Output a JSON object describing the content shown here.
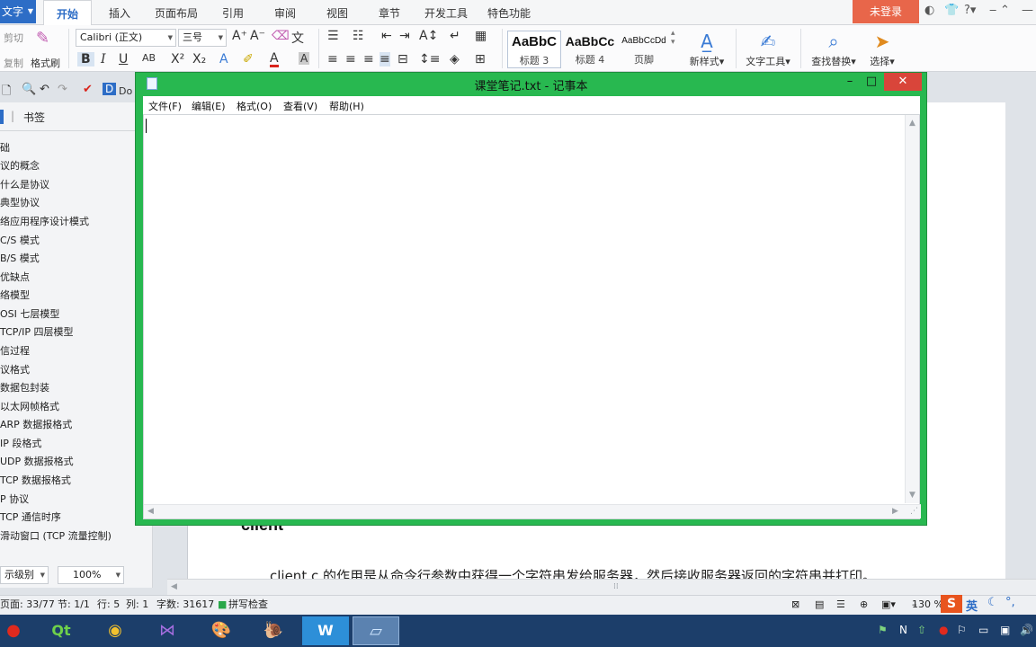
{
  "ribbon": {
    "app_menu": "文字",
    "tabs": [
      "开始",
      "插入",
      "页面布局",
      "引用",
      "审阅",
      "视图",
      "章节",
      "开发工具",
      "特色功能"
    ],
    "login": "未登录",
    "clipboard": {
      "cut": "剪切",
      "copy": "复制",
      "format_painter": "格式刷"
    },
    "font": {
      "name": "Calibri (正文)",
      "size": "三号"
    },
    "styles": [
      {
        "sample": "AaBbC",
        "name": "标题 3"
      },
      {
        "sample": "AaBbCc",
        "name": "标题 4"
      },
      {
        "sample": "AaBbCcDd",
        "name": "页脚"
      }
    ],
    "new_style": "新样式",
    "text_tools": "文字工具",
    "find_replace": "查找替换",
    "select": "选择"
  },
  "quickbar": {
    "doc_label": "Do"
  },
  "navpane": {
    "tab_bookmark": "书签",
    "items": [
      "础",
      "议的概念",
      "什么是协议",
      "典型协议",
      "络应用程序设计模式",
      "C/S 模式",
      "B/S 模式",
      "优缺点",
      "络模型",
      "OSI 七层模型",
      "TCP/IP 四层模型",
      "信过程",
      "议格式",
      "数据包封装",
      "以太网帧格式",
      "ARP 数据报格式",
      "IP 段格式",
      "UDP 数据报格式",
      "TCP 数据报格式",
      "P 协议",
      "TCP 通信时序",
      "滑动窗口 (TCP 流量控制)"
    ],
    "level": "示级别",
    "zoom": "100%"
  },
  "document": {
    "heading": "client",
    "paragraph": "client.c 的作用是从命令行参数中获得一个字符串发给服务器，然后接收服务器返回的字符串并打印。"
  },
  "statusbar": {
    "page": "页面: 33/77",
    "section": "节: 1/1",
    "row": "行: 5",
    "col": "列: 1",
    "words": "字数: 31617",
    "spell": "拼写检查",
    "zoom": "130 %"
  },
  "notepad": {
    "title": "课堂笔记.txt - 记事本",
    "menus": [
      "文件(F)",
      "编辑(E)",
      "格式(O)",
      "查看(V)",
      "帮助(H)"
    ],
    "content": ""
  },
  "tray": {
    "ime": "英"
  },
  "colors": {
    "accent": "#2d6dc6",
    "notepad_frame": "#28b850",
    "login": "#e8664a"
  }
}
